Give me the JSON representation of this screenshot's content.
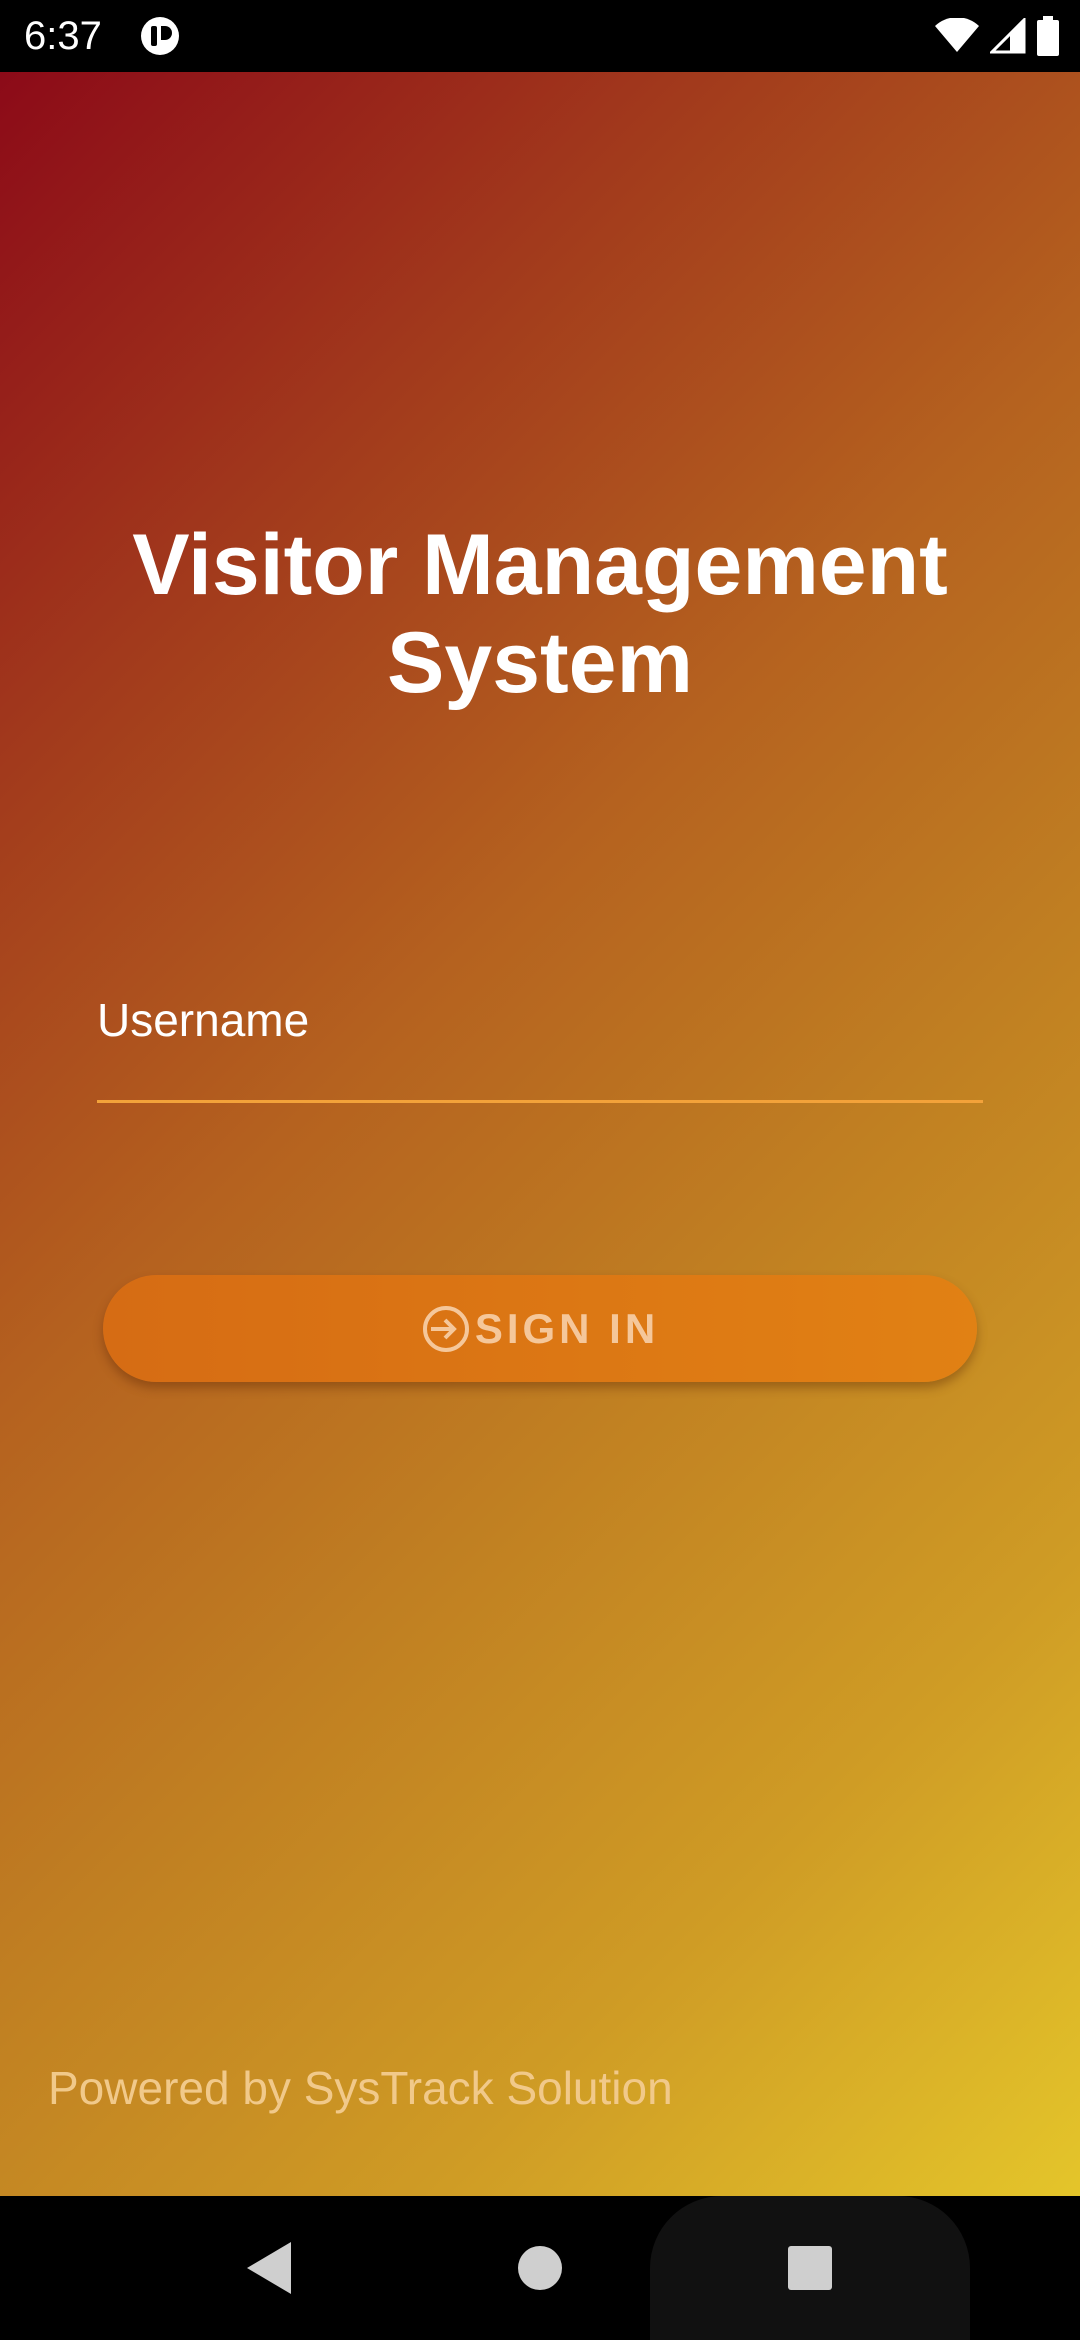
{
  "status_bar": {
    "time": "6:37",
    "app_icon": "app-notification-icon",
    "wifi_icon": "wifi-icon",
    "signal_icon": "cell-signal-icon",
    "battery_icon": "battery-icon"
  },
  "app": {
    "title": "Visitor Management System",
    "username_label": "Username",
    "username_value": "",
    "signin_label": "SIGN IN",
    "signin_icon": "login-arrow-icon",
    "powered_by": "Powered by SysTrack Solution"
  },
  "colors": {
    "gradient_start": "#8c0a18",
    "gradient_end": "#e4c52a",
    "button": "#e18114",
    "underline": "#f3a23a"
  },
  "nav_bar": {
    "back_icon": "back-triangle-icon",
    "home_icon": "home-circle-icon",
    "recents_icon": "recents-square-icon"
  }
}
